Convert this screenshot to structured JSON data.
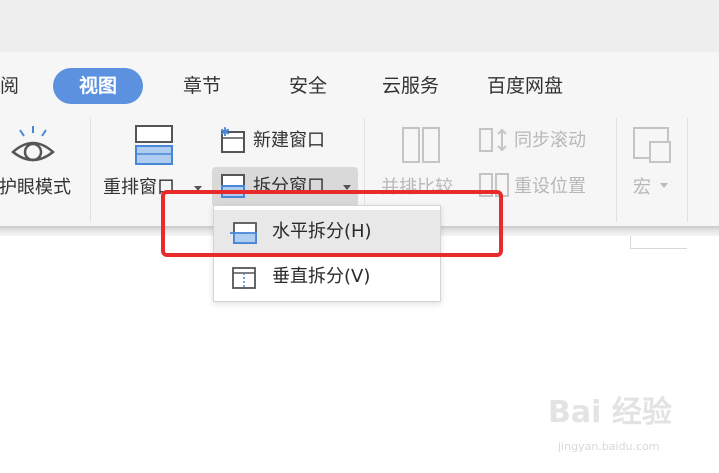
{
  "tabs": [
    {
      "label": "阅"
    },
    {
      "label": "视图"
    },
    {
      "label": "章节"
    },
    {
      "label": "安全"
    },
    {
      "label": "云服务"
    },
    {
      "label": "百度网盘"
    }
  ],
  "ribbon": {
    "eye_protection": "护眼模式",
    "rearrange_window": "重排窗口",
    "new_window": "新建窗口",
    "split_window": "拆分窗口",
    "side_by_side": "并排比较",
    "sync_scroll": "同步滚动",
    "reset_position": "重设位置",
    "macro": "宏"
  },
  "split_menu": {
    "items": [
      {
        "label": "水平拆分(H)",
        "icon": "horizontal-split-icon",
        "highlighted": true
      },
      {
        "label": "垂直拆分(V)",
        "icon": "vertical-split-icon",
        "highlighted": false
      }
    ]
  },
  "watermark": {
    "brand": "Bai 经验",
    "url": "jingyan.baidu.com"
  },
  "colors": {
    "accent": "#5b91de",
    "highlight_box": "#e82a2a"
  }
}
